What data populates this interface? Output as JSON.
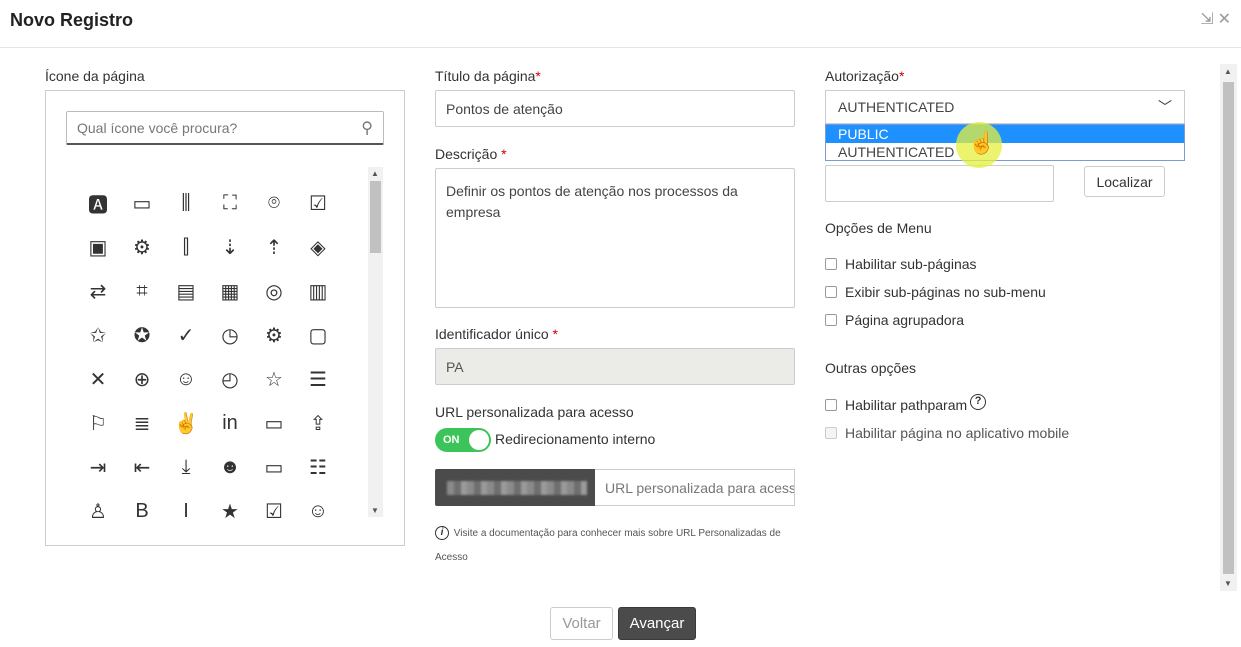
{
  "dialog": {
    "title": "Novo Registro"
  },
  "icons_panel": {
    "label": "Ícone da página",
    "search_placeholder": "Qual ícone você procura?",
    "icons": [
      {
        "name": "ab-speech-icon",
        "glyph": "🅰"
      },
      {
        "name": "ab-text-icon",
        "glyph": "▭"
      },
      {
        "name": "bar-chart-icon",
        "glyph": "⫼"
      },
      {
        "name": "fullscreen-icon",
        "glyph": "⛶"
      },
      {
        "name": "camera-icon",
        "glyph": "⌾"
      },
      {
        "name": "clipboard-check-icon",
        "glyph": "☑"
      },
      {
        "name": "document-box-icon",
        "glyph": "▣"
      },
      {
        "name": "document-gear-icon",
        "glyph": "⚙"
      },
      {
        "name": "ams-chart-icon",
        "glyph": "⫿"
      },
      {
        "name": "chart-down-icon",
        "glyph": "⇣"
      },
      {
        "name": "chart-up-icon",
        "glyph": "⇡"
      },
      {
        "name": "paint-bucket-icon",
        "glyph": "◈"
      },
      {
        "name": "arrows-swap-icon",
        "glyph": "⇄"
      },
      {
        "name": "crop-icon",
        "glyph": "⌗"
      },
      {
        "name": "presentation-icon",
        "glyph": "▤"
      },
      {
        "name": "monitor-icon",
        "glyph": "▦"
      },
      {
        "name": "fingerprint-icon",
        "glyph": "◎"
      },
      {
        "name": "ams-box-icon",
        "glyph": "▥"
      },
      {
        "name": "document-star-icon",
        "glyph": "✩"
      },
      {
        "name": "document-award-icon",
        "glyph": "✪"
      },
      {
        "name": "document-check-icon",
        "glyph": "✓"
      },
      {
        "name": "document-clock-icon",
        "glyph": "◷"
      },
      {
        "name": "document-settings-icon",
        "glyph": "⚙"
      },
      {
        "name": "calendar-icon",
        "glyph": "▢"
      },
      {
        "name": "document-x-icon",
        "glyph": "✕"
      },
      {
        "name": "document-globe-icon",
        "glyph": "⊕"
      },
      {
        "name": "document-user-icon",
        "glyph": "☺"
      },
      {
        "name": "clock-box-icon",
        "glyph": "◴"
      },
      {
        "name": "user-star-icon",
        "glyph": "☆"
      },
      {
        "name": "filter-lines-icon",
        "glyph": "☰"
      },
      {
        "name": "flag-icon",
        "glyph": "⚐"
      },
      {
        "name": "text-box-icon",
        "glyph": "≣"
      },
      {
        "name": "thumbs-up-icon",
        "glyph": "✌"
      },
      {
        "name": "linkedin-icon",
        "glyph": "in"
      },
      {
        "name": "folder-user-icon",
        "glyph": "▭"
      },
      {
        "name": "upload-box-icon",
        "glyph": "⇪"
      },
      {
        "name": "arrow-right-bar-icon",
        "glyph": "⇥"
      },
      {
        "name": "arrow-left-bar-icon",
        "glyph": "⇤"
      },
      {
        "name": "download-box-icon",
        "glyph": "⤓"
      },
      {
        "name": "users-icon",
        "glyph": "☻"
      },
      {
        "name": "id-card-icon",
        "glyph": "▭"
      },
      {
        "name": "graduate-list-icon",
        "glyph": "☷"
      },
      {
        "name": "graduate-icon",
        "glyph": "♙"
      },
      {
        "name": "bold-icon",
        "glyph": "B"
      },
      {
        "name": "italic-icon",
        "glyph": "I"
      },
      {
        "name": "speech-star-icon",
        "glyph": "★"
      },
      {
        "name": "checkbox-icon",
        "glyph": "☑"
      },
      {
        "name": "smile-icon",
        "glyph": "☺"
      }
    ]
  },
  "form": {
    "title_label": "Título da página",
    "title_value": "Pontos de atenção",
    "description_label": "Descrição",
    "description_value": "Definir os pontos de atenção nos processos da empresa",
    "identifier_label": "Identificador único",
    "identifier_value": "PA",
    "url_label": "URL personalizada para acesso",
    "toggle_state": "ON",
    "toggle_label": "Redirecionamento interno",
    "url_placeholder": "URL personalizada para acesso",
    "doc_note": "Visite a documentação para conhecer mais sobre URL Personalizadas de Acesso",
    "required_mark": "*"
  },
  "authorization": {
    "label": "Autorização",
    "selected": "AUTHENTICATED",
    "options": [
      "PUBLIC",
      "AUTHENTICATED"
    ],
    "highlighted_option": "PUBLIC",
    "locate_button": "Localizar"
  },
  "menu_options": {
    "title": "Opções de Menu",
    "items": [
      "Habilitar sub-páginas",
      "Exibir sub-páginas no sub-menu",
      "Página agrupadora"
    ]
  },
  "other_options": {
    "title": "Outras opções",
    "pathparam": "Habilitar pathparam",
    "mobile": "Habilitar página no aplicativo mobile"
  },
  "footer": {
    "back": "Voltar",
    "next": "Avançar"
  }
}
